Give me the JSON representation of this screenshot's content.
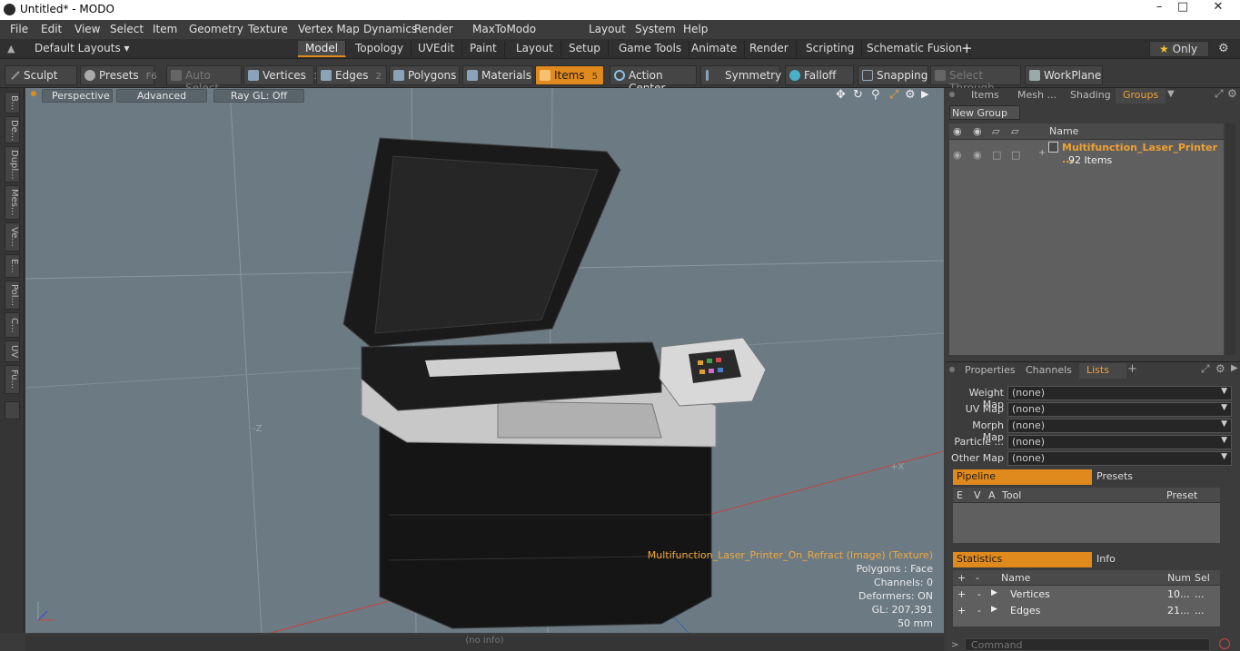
{
  "window": {
    "title": "Untitled* - MODO"
  },
  "menu": [
    "File",
    "Edit",
    "View",
    "Select",
    "Item",
    "Geometry",
    "Texture",
    "Vertex Map",
    "Dynamics",
    "Render",
    "MaxToModo",
    "Layout",
    "System",
    "Help"
  ],
  "layout_bar": {
    "layouts_label": "Default Layouts",
    "tabs": [
      "Model",
      "Topology",
      "UVEdit",
      "Paint",
      "Layout",
      "Setup",
      "Game Tools",
      "Animate",
      "Render",
      "Scripting",
      "Schematic Fusion"
    ],
    "active_tab": "Model",
    "only_label": "Only"
  },
  "toolbar": {
    "sculpt": "Sculpt",
    "presets": "Presets",
    "presets_key": "F6",
    "auto_select": "Auto Select",
    "vertices": "Vertices",
    "vertices_num": "1",
    "edges": "Edges",
    "edges_num": "2",
    "polygons": "Polygons",
    "materials": "Materials",
    "items": "Items",
    "items_num": "5",
    "action_center": "Action Center",
    "symmetry": "Symmetry",
    "falloff": "Falloff",
    "snapping": "Snapping",
    "select_through": "Select Through",
    "workplane": "WorkPlane"
  },
  "left_tabs": [
    "B...",
    "De...",
    "Dupl...",
    "Mes...",
    "Ve...",
    "E...",
    "Pol...",
    "C...",
    "UV",
    "Fu..."
  ],
  "viewport": {
    "perspective": "Perspective",
    "advanced": "Advanced",
    "raygl": "Ray GL: Off",
    "info_title": "Multifunction_Laser_Printer_On_Refract (Image) (Texture)",
    "polygons": "Polygons : Face",
    "channels": "Channels: 0",
    "deformers": "Deformers: ON",
    "gl": "GL: 207,391",
    "scale": "50 mm",
    "axis_z": "-Z",
    "axis_x": "+X"
  },
  "status": {
    "text": "(no info)"
  },
  "groups_panel": {
    "tabs": [
      "Items",
      "Mesh ...",
      "Shading",
      "Groups"
    ],
    "active_tab": "Groups",
    "new_group": "New Group",
    "col_name": "Name",
    "group_name": "Multifunction_Laser_Printer ...",
    "group_count": "92 Items"
  },
  "props_panel": {
    "tabs": [
      "Properties",
      "Channels",
      "Lists"
    ],
    "active_tab": "Lists",
    "maps": [
      {
        "label": "Weight Map",
        "value": "(none)"
      },
      {
        "label": "UV Map",
        "value": "(none)"
      },
      {
        "label": "Morph Map",
        "value": "(none)"
      },
      {
        "label": "Particle ...",
        "value": "(none)"
      },
      {
        "label": "Other Map",
        "value": "(none)"
      }
    ],
    "pipeline": "Pipeline",
    "presets": "Presets",
    "pipe_cols": [
      "E",
      "V",
      "A",
      "Tool",
      "Preset"
    ],
    "statistics": "Statistics",
    "info": "Info",
    "stat_cols": [
      "+",
      "-",
      "Name",
      "Num",
      "Sel"
    ],
    "stat_rows": [
      {
        "name": "Vertices",
        "num": "10...",
        "sel": "..."
      },
      {
        "name": "Edges",
        "num": "21...",
        "sel": "..."
      }
    ],
    "command_placeholder": "Command"
  }
}
